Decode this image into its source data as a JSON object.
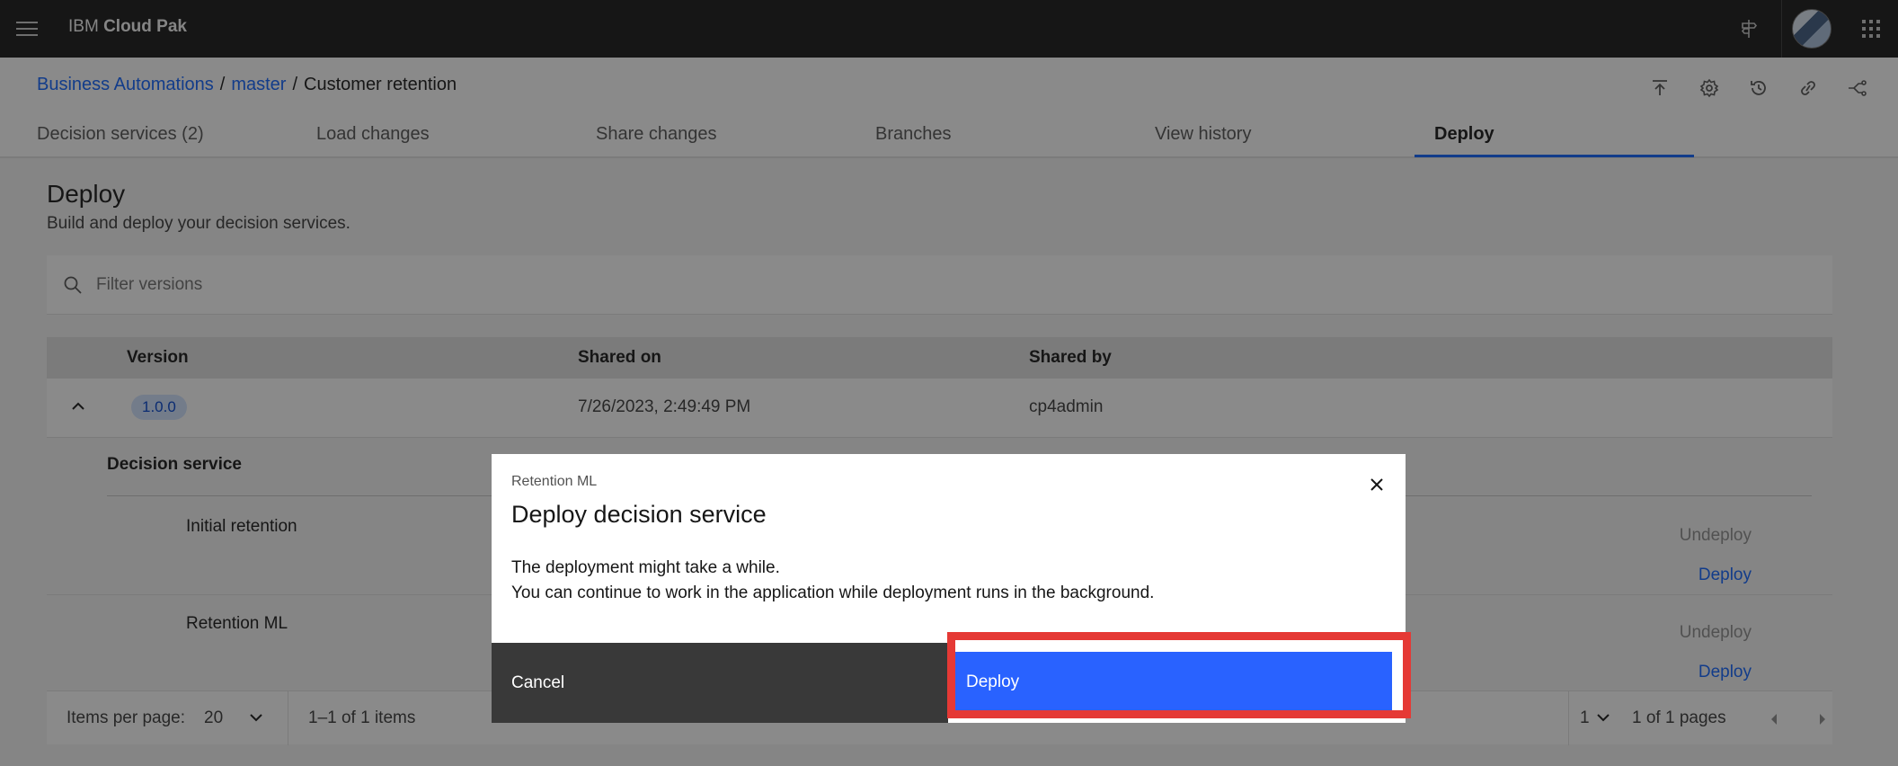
{
  "header": {
    "brand_prefix": "IBM",
    "brand_name": "Cloud Pak"
  },
  "breadcrumb": {
    "items": [
      "Business Automations",
      "master"
    ],
    "separator": "/",
    "current": "Customer retention"
  },
  "tabs": [
    {
      "label": "Decision services (2)"
    },
    {
      "label": "Load changes"
    },
    {
      "label": "Share changes"
    },
    {
      "label": "Branches"
    },
    {
      "label": "View history"
    },
    {
      "label": "Deploy",
      "active": true
    }
  ],
  "page": {
    "title": "Deploy",
    "description": "Build and deploy your decision services."
  },
  "search": {
    "placeholder": "Filter versions"
  },
  "table": {
    "headers": [
      "Version",
      "Shared on",
      "Shared by"
    ],
    "row": {
      "version": "1.0.0",
      "shared_on": "7/26/2023, 2:49:49 PM",
      "shared_by": "cp4admin"
    },
    "subheader": "Decision service",
    "services": [
      {
        "name": "Initial retention",
        "undeploy": "Undeploy",
        "deploy": "Deploy"
      },
      {
        "name": "Retention ML",
        "undeploy": "Undeploy",
        "deploy": "Deploy"
      }
    ]
  },
  "pagination": {
    "items_per_page_label": "Items per page:",
    "items_per_page": "20",
    "range": "1–1 of 1 items",
    "page": "1",
    "pages": "1 of 1 pages"
  },
  "modal": {
    "label": "Retention ML",
    "title": "Deploy decision service",
    "body_line1": "The deployment might take a while.",
    "body_line2": "You can continue to work in the application while deployment runs in the background.",
    "cancel_label": "Cancel",
    "deploy_label": "Deploy"
  },
  "colors": {
    "accent": "#0f62fe",
    "deploy_button": "#2962ff",
    "highlight": "#e53935",
    "header_bg": "#161616"
  }
}
